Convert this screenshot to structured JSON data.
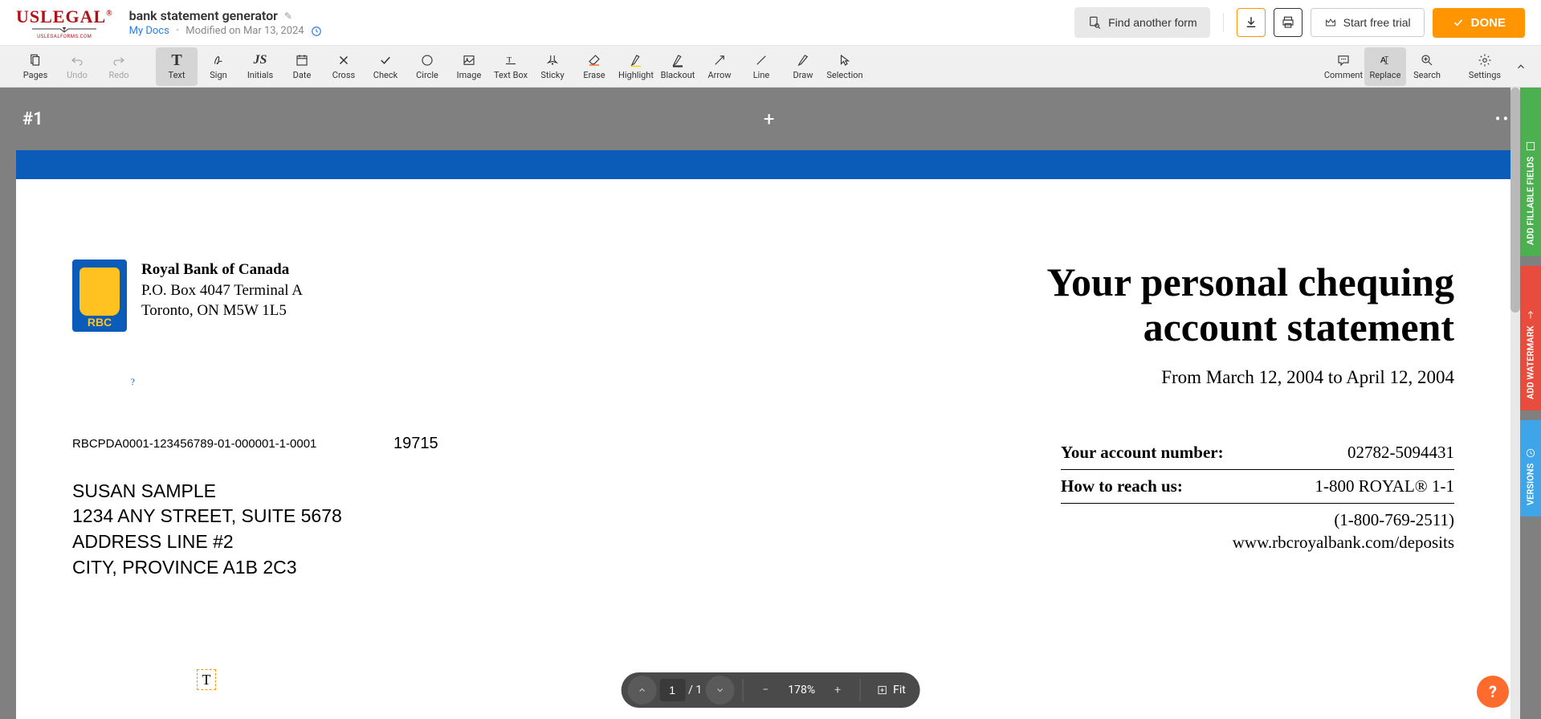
{
  "header": {
    "logo": "USLEGAL",
    "logo_sub": "USLEGALFORMS.COM",
    "doc_title": "bank statement generator",
    "my_docs": "My Docs",
    "modified": "Modified on Mar 13, 2024",
    "find_form": "Find another form",
    "trial": "Start free trial",
    "done": "DONE"
  },
  "toolbar": [
    {
      "label": "Pages",
      "icon": "pages"
    },
    {
      "label": "Undo",
      "icon": "undo",
      "disabled": true
    },
    {
      "label": "Redo",
      "icon": "redo",
      "disabled": true
    },
    {
      "gap": true
    },
    {
      "label": "Text",
      "icon": "text",
      "active": true
    },
    {
      "label": "Sign",
      "icon": "sign"
    },
    {
      "label": "Initials",
      "icon": "initials"
    },
    {
      "label": "Date",
      "icon": "date"
    },
    {
      "label": "Cross",
      "icon": "cross"
    },
    {
      "label": "Check",
      "icon": "check"
    },
    {
      "label": "Circle",
      "icon": "circle"
    },
    {
      "label": "Image",
      "icon": "image"
    },
    {
      "label": "Text Box",
      "icon": "textbox"
    },
    {
      "label": "Sticky",
      "icon": "sticky"
    },
    {
      "label": "Erase",
      "icon": "erase"
    },
    {
      "label": "Highlight",
      "icon": "highlight"
    },
    {
      "label": "Blackout",
      "icon": "blackout"
    },
    {
      "label": "Arrow",
      "icon": "arrow"
    },
    {
      "label": "Line",
      "icon": "line"
    },
    {
      "label": "Draw",
      "icon": "draw"
    },
    {
      "label": "Selection",
      "icon": "selection"
    },
    {
      "spacer": true
    },
    {
      "label": "Comment",
      "icon": "comment"
    },
    {
      "label": "Replace",
      "icon": "replace",
      "active": true
    },
    {
      "label": "Search",
      "icon": "search"
    },
    {
      "gap": true
    },
    {
      "label": "Settings",
      "icon": "settings"
    }
  ],
  "viewer": {
    "page_num": "#1",
    "add": "+",
    "more": "•••"
  },
  "document": {
    "bank_name": "Royal Bank of Canada",
    "bank_addr1": "P.O. Box 4047 Terminal A",
    "bank_addr2": "Toronto, ON  M5W 1L5",
    "rbc": "RBC",
    "title_line1": "Your personal chequing",
    "title_line2": "account statement",
    "date_range": "From March 12, 2004 to April 12, 2004",
    "ref_code": "RBCPDA0001-123456789-01-000001-1-0001",
    "ref_num": "19715",
    "customer_name": "SUSAN SAMPLE",
    "addr1": "1234 ANY STREET, SUITE 5678",
    "addr2": "ADDRESS LINE #2",
    "addr3": "CITY, PROVINCE  A1B 2C3",
    "acct_label": "Your account number:",
    "acct_value": "02782-5094431",
    "reach_label": "How to reach us:",
    "reach_value": "1-800 ROYAL® 1-1",
    "reach_phone": "(1-800-769-2511)",
    "reach_web": "www.rbcroyalbank.com/deposits",
    "cursor": "T"
  },
  "nav": {
    "current": "1",
    "total": "/ 1",
    "zoom": "178%",
    "fit": "Fit"
  },
  "side": {
    "fillable": "ADD FILLABLE FIELDS",
    "watermark": "ADD WATERMARK",
    "versions": "VERSIONS"
  }
}
